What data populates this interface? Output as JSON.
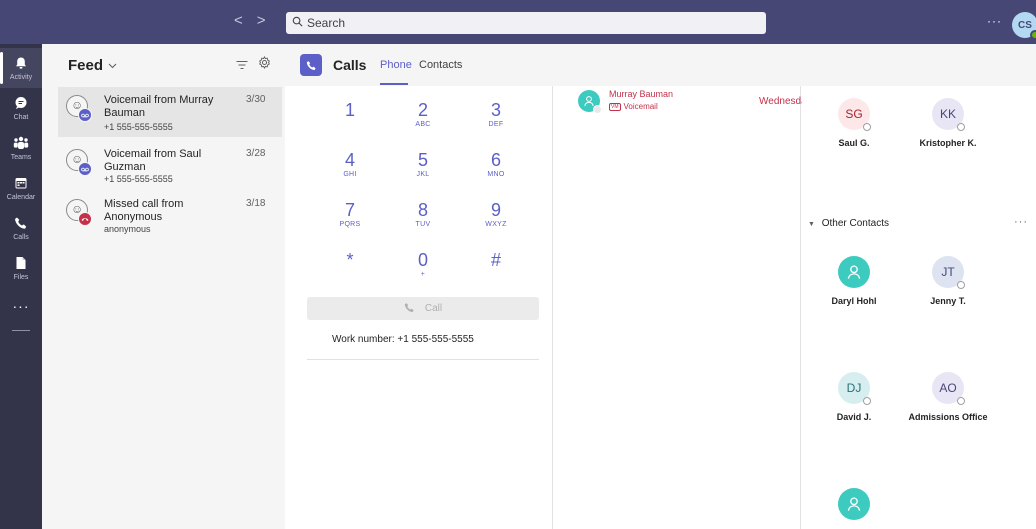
{
  "topbar": {
    "back_arrow": "<",
    "forward_arrow": ">",
    "search_placeholder": "Search",
    "more": "···",
    "user_initials": "CS"
  },
  "rail": {
    "items": [
      {
        "label": "Activity",
        "icon": "bell-icon",
        "glyph": "🔔"
      },
      {
        "label": "Chat",
        "icon": "chat-icon",
        "glyph": "💬"
      },
      {
        "label": "Teams",
        "icon": "teams-icon",
        "glyph": "👥"
      },
      {
        "label": "Calendar",
        "icon": "calendar-icon",
        "glyph": "📅"
      },
      {
        "label": "Calls",
        "icon": "phone-icon",
        "glyph": "📞"
      },
      {
        "label": "Files",
        "icon": "file-icon",
        "glyph": "📄"
      }
    ],
    "more": "···"
  },
  "feed": {
    "title": "Feed",
    "items": [
      {
        "title": "Voicemail from Murray Bauman",
        "sub": "+1 555-555-5555",
        "date": "3/30",
        "badge": "voicemail",
        "badge_color": "#5b5fc7"
      },
      {
        "title": "Voicemail from Saul Guzman",
        "sub": "+1 555-555-5555",
        "date": "3/28",
        "badge": "voicemail",
        "badge_color": "#5b5fc7"
      },
      {
        "title": "Missed call from Anonymous",
        "sub": "anonymous",
        "date": "3/18",
        "badge": "missed-call",
        "badge_color": "#c4314b"
      }
    ]
  },
  "calls": {
    "title": "Calls",
    "tabs": [
      "Phone",
      "Contacts"
    ],
    "accent": "#5b5fc7"
  },
  "dialpad": {
    "keys": [
      {
        "d": "1",
        "l": ""
      },
      {
        "d": "2",
        "l": "ABC"
      },
      {
        "d": "3",
        "l": "DEF"
      },
      {
        "d": "4",
        "l": "GHI"
      },
      {
        "d": "5",
        "l": "JKL"
      },
      {
        "d": "6",
        "l": "MNO"
      },
      {
        "d": "7",
        "l": "PQRS"
      },
      {
        "d": "8",
        "l": "TUV"
      },
      {
        "d": "9",
        "l": "WXYZ"
      },
      {
        "d": "*",
        "l": ""
      },
      {
        "d": "0",
        "l": "+"
      },
      {
        "d": "#",
        "l": ""
      }
    ],
    "call_label": "Call",
    "work_number_label": "Work number:",
    "work_number": "+1 555-555-5555"
  },
  "history": {
    "name": "Murray Bauman",
    "type": "Voicemail",
    "day": "Wednesday",
    "missed_color": "#c4314b"
  },
  "contacts": {
    "speed_dial": [
      {
        "initials": "SG",
        "name": "Saul G.",
        "bg": "#fde7e9",
        "fg": "#a4262c"
      },
      {
        "initials": "KK",
        "name": "Kristopher K.",
        "bg": "#e8e6f5",
        "fg": "#464775"
      }
    ],
    "other_title": "Other Contacts",
    "other_more": "···",
    "other": [
      {
        "initials": "",
        "name": "Daryl Hohl",
        "bg": "#3ecbbf",
        "fg": "#fff"
      },
      {
        "initials": "JT",
        "name": "Jenny T.",
        "bg": "#dde3f0",
        "fg": "#464775"
      },
      {
        "initials": "DJ",
        "name": "David J.",
        "bg": "#d7eef0",
        "fg": "#2a6f73"
      },
      {
        "initials": "AO",
        "name": "Admissions Office",
        "bg": "#e8e6f5",
        "fg": "#464775"
      },
      {
        "initials": "",
        "name": "",
        "bg": "#3ecbbf",
        "fg": "#fff"
      }
    ]
  }
}
